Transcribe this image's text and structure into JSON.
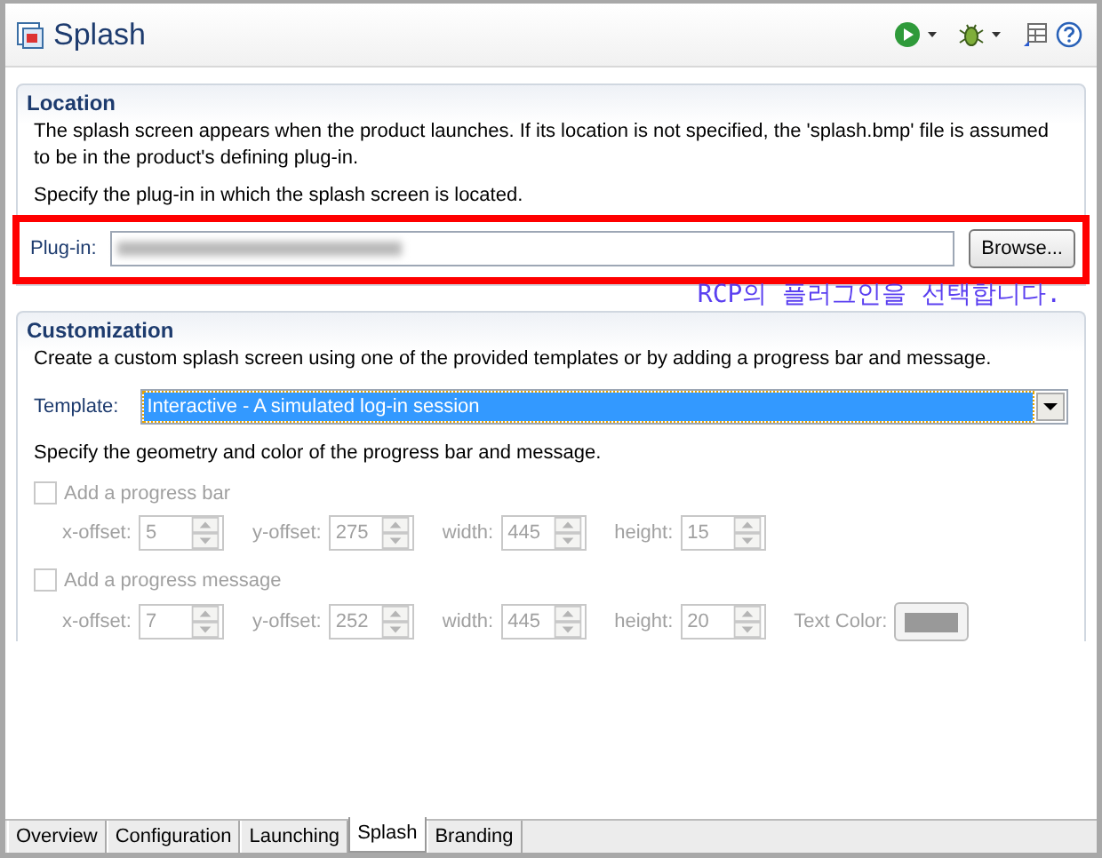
{
  "editor": {
    "title": "Splash"
  },
  "location": {
    "title": "Location",
    "description": "The splash screen appears when the product launches.  If its location is not specified, the 'splash.bmp' file is assumed to be in the product's defining plug-in.",
    "prompt": "Specify the plug-in in which the splash screen is located.",
    "plugin_label": "Plug-in:",
    "browse_button": "Browse..."
  },
  "annotation": {
    "text": "RCP의 플러그인을 선택합니다."
  },
  "customization": {
    "title": "Customization",
    "description": "Create a custom splash screen using one of the provided templates or by adding a progress bar and message.",
    "template_label": "Template:",
    "template_value": "Interactive - A simulated log-in session",
    "geometry_prompt": "Specify the geometry and color of the progress bar and message.",
    "groups": [
      {
        "label": "Add a progress bar",
        "checked": false,
        "disabled": true,
        "fields": [
          {
            "label": "x-offset:",
            "value": "5"
          },
          {
            "label": "y-offset:",
            "value": "275"
          },
          {
            "label": "width:",
            "value": "445"
          },
          {
            "label": "height:",
            "value": "15"
          }
        ]
      },
      {
        "label": "Add a progress message",
        "checked": false,
        "disabled": true,
        "fields": [
          {
            "label": "x-offset:",
            "value": "7"
          },
          {
            "label": "y-offset:",
            "value": "252"
          },
          {
            "label": "width:",
            "value": "445"
          },
          {
            "label": "height:",
            "value": "20"
          }
        ],
        "color_label": "Text Color:"
      }
    ]
  },
  "tabs": [
    {
      "label": "Overview",
      "selected": false
    },
    {
      "label": "Configuration",
      "selected": false
    },
    {
      "label": "Launching",
      "selected": false
    },
    {
      "label": "Splash",
      "selected": true
    },
    {
      "label": "Branding",
      "selected": false
    }
  ]
}
